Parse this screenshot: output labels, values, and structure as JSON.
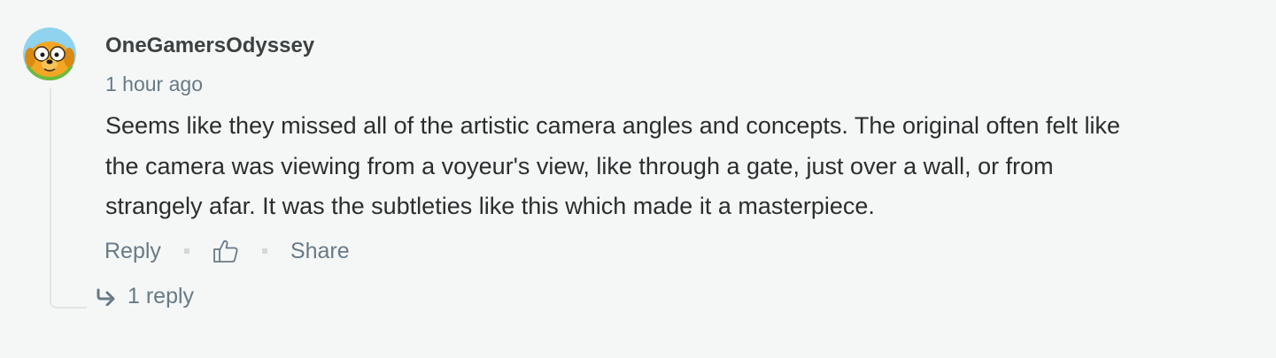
{
  "comment": {
    "author": "OneGamersOdyssey",
    "timestamp": "1 hour ago",
    "body_lines": [
      "Seems like they missed all of the artistic camera angles and concepts. The original often felt like",
      "the camera was viewing from a voyeur's view, like through a gate, just over a wall, or from",
      "strangely afar. It was the subtleties like this which made it a masterpiece."
    ],
    "avatar_icon": "cartoon-dog-avatar"
  },
  "actions": {
    "reply_label": "Reply",
    "like_icon": "thumbs-up-icon",
    "share_label": "Share"
  },
  "replies": {
    "icon": "reply-arrow-icon",
    "label": "1 reply"
  },
  "colors": {
    "background": "#f5f7f7",
    "author": "#3c4142",
    "muted": "#687a86",
    "body": "#2a2e2e",
    "separator": "#d4d8da"
  }
}
